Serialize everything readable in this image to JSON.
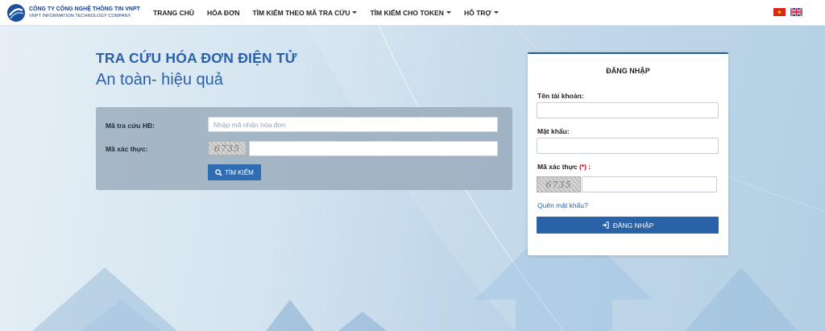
{
  "logo": {
    "line1": "CÔNG TY CÔNG NGHỆ THÔNG TIN VNPT",
    "line2": "VNPT INFORMATION TECHNOLOGY COMPANY"
  },
  "nav": {
    "items": [
      {
        "label": "TRANG CHỦ",
        "dropdown": false
      },
      {
        "label": "HÓA ĐƠN",
        "dropdown": false
      },
      {
        "label": "TÌM KIẾM THEO MÃ TRA CỨU",
        "dropdown": true
      },
      {
        "label": "TÌM KIẾM CHO TOKEN",
        "dropdown": true
      },
      {
        "label": "HỖ TRỢ",
        "dropdown": true
      }
    ],
    "flags": [
      "vietnam-flag-icon",
      "uk-flag-icon"
    ]
  },
  "hero": {
    "title": "TRA CỨU HÓA ĐƠN ĐIỆN TỬ",
    "subtitle": "An toàn- hiệu quả"
  },
  "search": {
    "code_label": "Mã tra cứu HĐ:",
    "code_placeholder": "Nhập mã nhận hóa đơn",
    "captcha_label": "Mã xác thực:",
    "captcha_text": "6735",
    "button_label": "TÌM KIẾM",
    "button_icon": "search-icon"
  },
  "login": {
    "title": "ĐĂNG NHẬP",
    "username_label": "Tên tài khoản:",
    "password_label": "Mật khẩu:",
    "captcha_label": "Mã xác thực",
    "captcha_required": "(*)",
    "captcha_colon": ":",
    "captcha_text": "6735",
    "forgot_label": "Quên mật khẩu?",
    "button_label": "ĐĂNG NHẬP",
    "button_icon": "sign-in-icon"
  },
  "colors": {
    "brand": "#2a62a8",
    "button": "#2f6db3",
    "required": "#d0021b"
  }
}
